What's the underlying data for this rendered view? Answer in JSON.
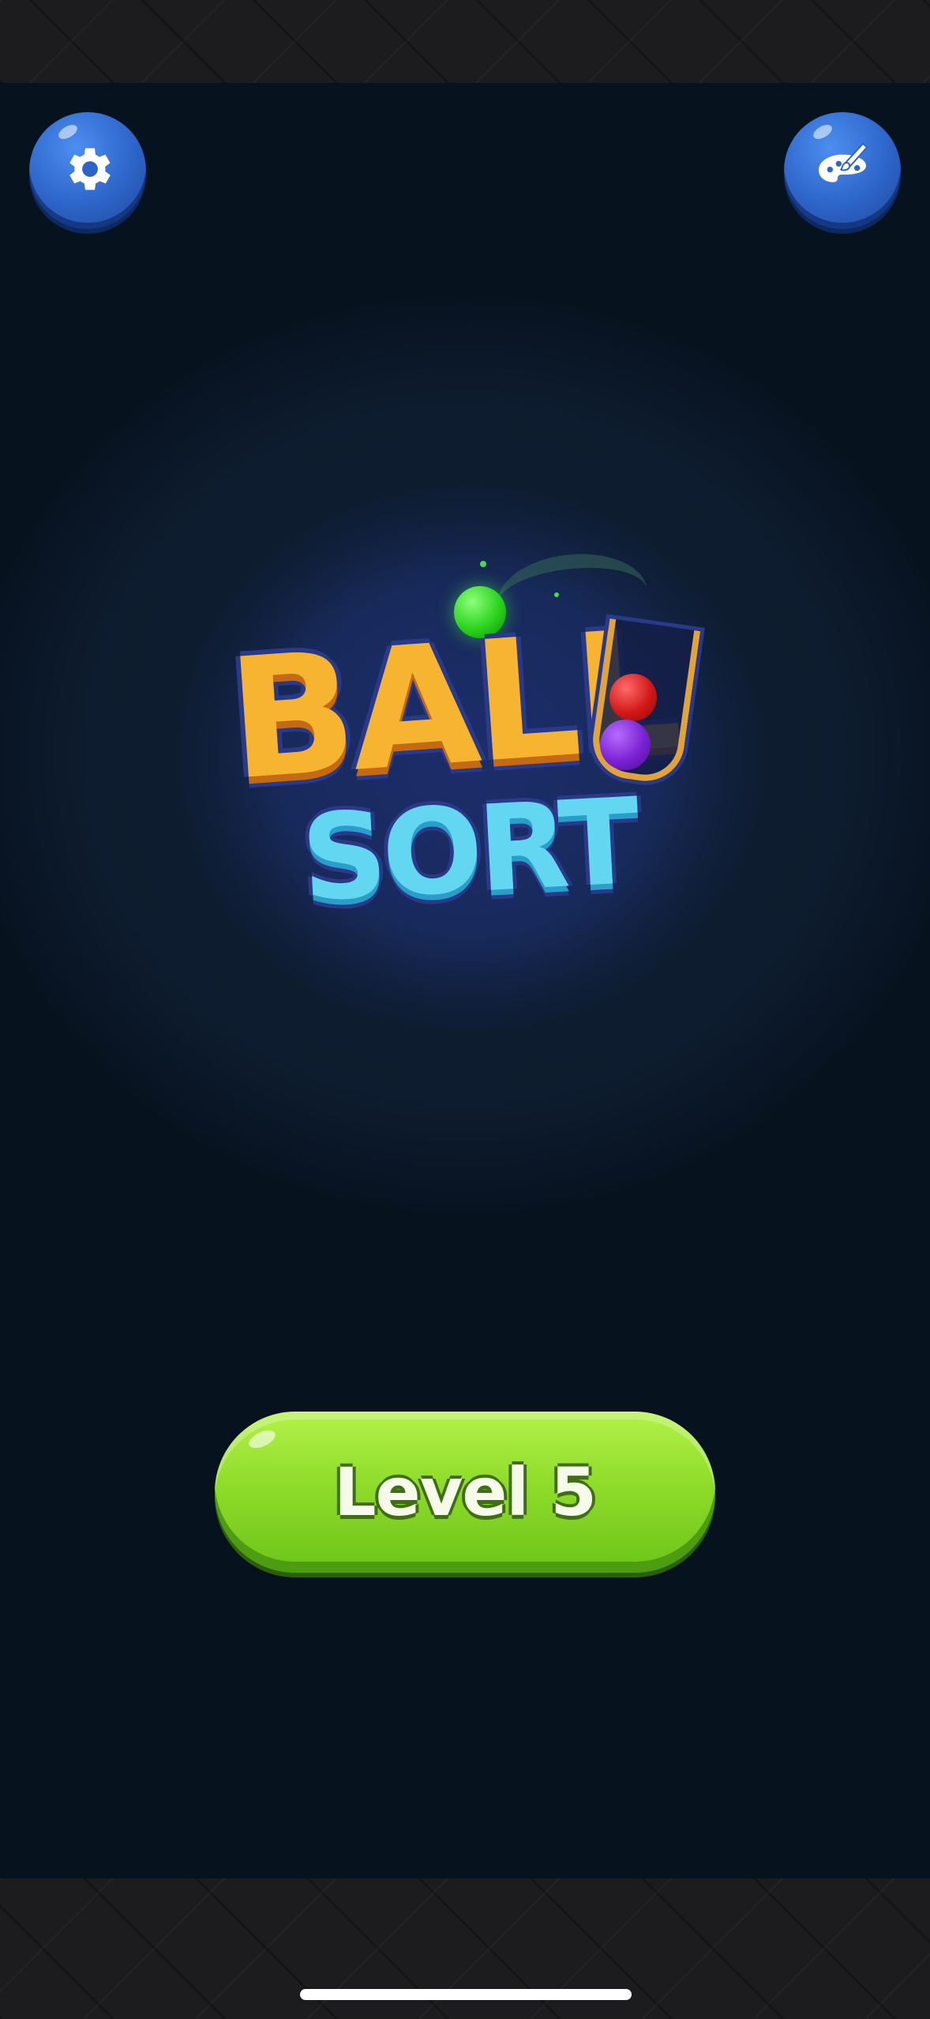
{
  "header": {
    "settings_icon": "gear-icon",
    "theme_icon": "palette-brush-icon"
  },
  "logo": {
    "word1": "BALL",
    "word2": "SORT",
    "ball_colors": [
      "#2bd31e",
      "#d21818",
      "#7a22d4"
    ]
  },
  "level_button": {
    "label": "Level 5"
  },
  "colors": {
    "background": "#07121f",
    "button_blue": "#2d64c8",
    "button_green": "#8fdc2a",
    "logo_orange": "#f7b431",
    "logo_cyan": "#63d6f2"
  }
}
